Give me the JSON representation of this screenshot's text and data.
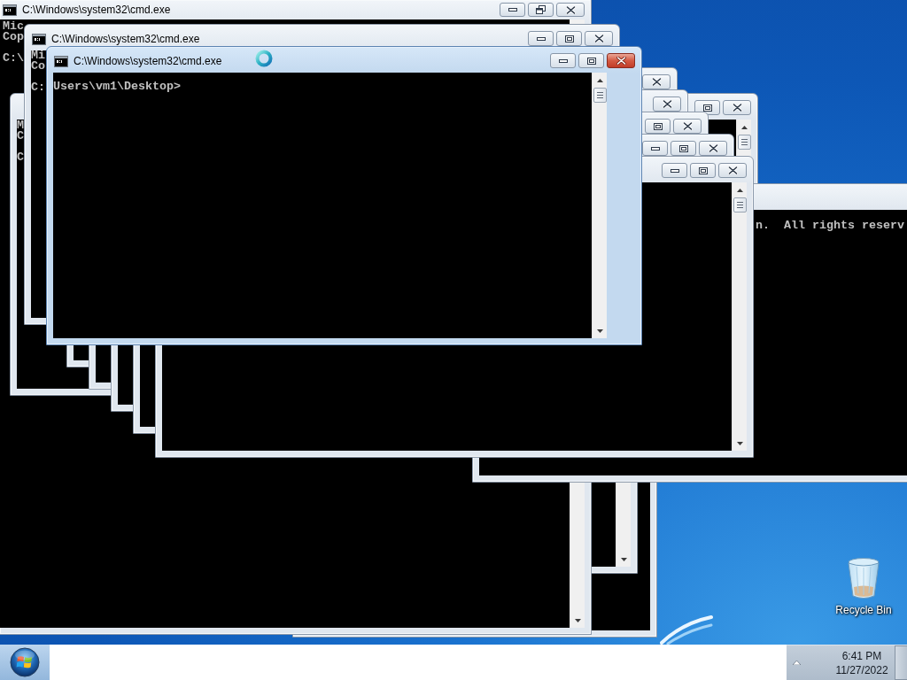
{
  "desktop": {
    "windows": [
      {
        "kind": "console"
      },
      {
        "kind": "console"
      },
      {
        "kind": "console",
        "title": "C:\\Windows\\system32\\cmd.exe",
        "active": false,
        "maximized": true,
        "console_lines": [
          "Mic",
          "Cop",
          "C:\\"
        ]
      },
      {
        "kind": "console",
        "active": false,
        "maximized": false,
        "console_lines": [
          "M",
          "C",
          "C"
        ]
      },
      {
        "kind": "console",
        "console_lines": [
          "n.  All rights reserv"
        ]
      },
      {
        "kind": "console",
        "active": false
      },
      {
        "kind": "console",
        "active": false
      },
      {
        "kind": "console",
        "active": false,
        "maximized": false
      },
      {
        "kind": "console",
        "active": false,
        "maximized": false
      },
      {
        "kind": "console",
        "active": false,
        "maximized": false
      },
      {
        "kind": "console",
        "title": "C:\\Windows\\system32\\cmd.exe",
        "active": false,
        "maximized": false,
        "console_lines": [
          "Mi",
          "Co",
          "C:"
        ]
      },
      {
        "kind": "console",
        "title": "C:\\Windows\\system32\\cmd.exe",
        "active": true,
        "maximized": false,
        "console_lines": [
          "Users\\vm1\\Desktop>"
        ]
      }
    ],
    "shortcuts": [
      {
        "label": "Recycle Bin"
      }
    ]
  },
  "taskbar": {
    "clock": {
      "time": "6:41 PM",
      "date": "11/27/2022"
    }
  }
}
